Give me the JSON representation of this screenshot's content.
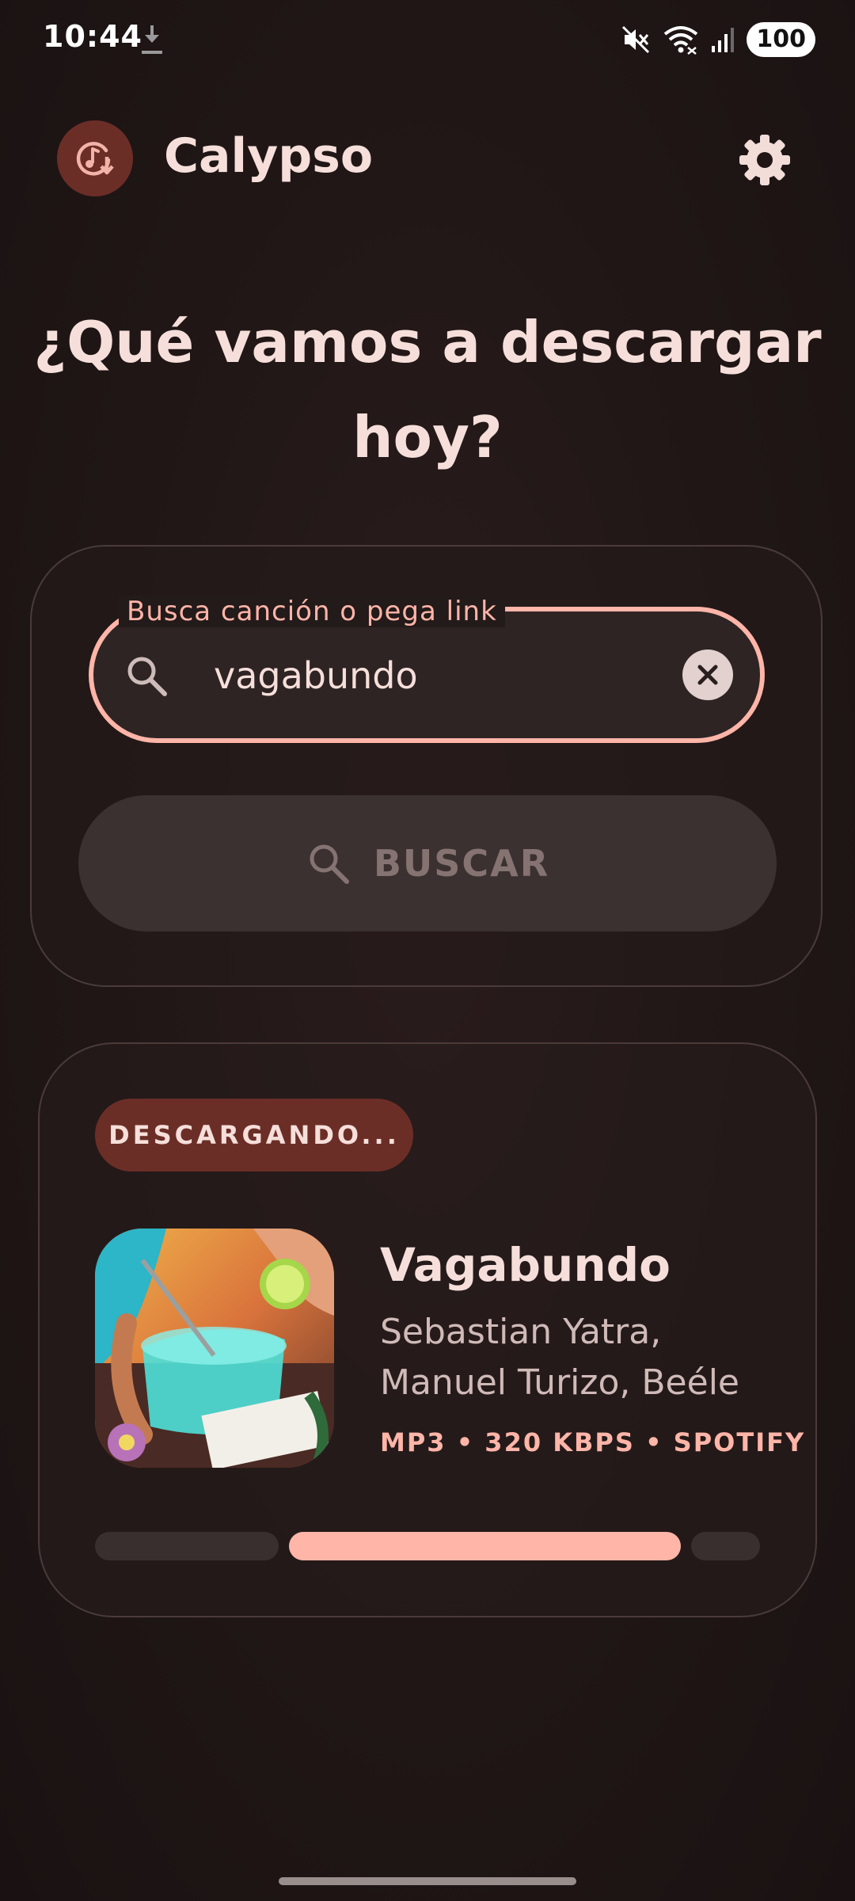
{
  "status_bar": {
    "time": "10:44",
    "battery": "100",
    "icons": [
      "download-icon",
      "mute-icon",
      "wifi-icon",
      "signal-icon"
    ]
  },
  "app_bar": {
    "title": "Calypso",
    "logo_icon": "music-download-icon",
    "settings_icon": "gear-icon"
  },
  "heading": "¿Qué vamos a descargar hoy?",
  "search": {
    "label": "Busca canción o pega link",
    "value": "vagabundo",
    "button_label": "BUSCAR"
  },
  "download": {
    "status": "DESCARGANDO...",
    "track": {
      "title": "Vagabundo",
      "artists": "Sebastian Yatra, Manuel Turizo, Beéle",
      "meta": "MP3 • 320 KBPS • SPOTIFY"
    }
  },
  "colors": {
    "accent": "#ffb5a8",
    "chip": "#6b2e27",
    "background": "#201616"
  }
}
